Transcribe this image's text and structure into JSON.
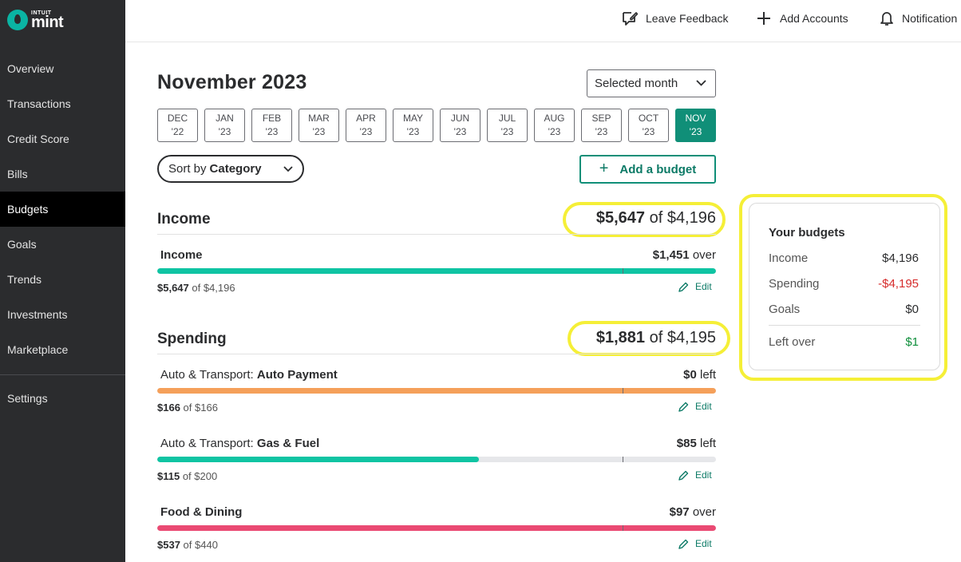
{
  "brand": {
    "intuit": "INTUIT",
    "name": "mint"
  },
  "sidebar": {
    "items": [
      {
        "label": "Overview"
      },
      {
        "label": "Transactions"
      },
      {
        "label": "Credit Score"
      },
      {
        "label": "Bills"
      },
      {
        "label": "Budgets",
        "active": true
      },
      {
        "label": "Goals"
      },
      {
        "label": "Trends"
      },
      {
        "label": "Investments"
      },
      {
        "label": "Marketplace"
      },
      {
        "label": "Settings"
      }
    ]
  },
  "topbar": {
    "feedback_label": "Leave Feedback",
    "add_accounts_label": "Add Accounts",
    "notifications_label": "Notification"
  },
  "page": {
    "title": "November 2023",
    "month_select": "Selected month",
    "months": [
      {
        "m": "DEC",
        "y": "'22"
      },
      {
        "m": "JAN",
        "y": "'23"
      },
      {
        "m": "FEB",
        "y": "'23"
      },
      {
        "m": "MAR",
        "y": "'23"
      },
      {
        "m": "APR",
        "y": "'23"
      },
      {
        "m": "MAY",
        "y": "'23"
      },
      {
        "m": "JUN",
        "y": "'23"
      },
      {
        "m": "JUL",
        "y": "'23"
      },
      {
        "m": "AUG",
        "y": "'23"
      },
      {
        "m": "SEP",
        "y": "'23"
      },
      {
        "m": "OCT",
        "y": "'23"
      },
      {
        "m": "NOV",
        "y": "'23",
        "active": true
      }
    ],
    "sort_prefix": "Sort by",
    "sort_value": "Category",
    "add_budget_label": "Add a budget"
  },
  "income": {
    "title": "Income",
    "total_actual": "$5,647",
    "total_of": "of $4,196",
    "rows": [
      {
        "category": "",
        "name": "Income",
        "status_amount": "$1,451",
        "status_word": "over",
        "actual": "$5,647",
        "of": "of $4,196",
        "edit": "Edit",
        "progress": 1.0,
        "color": "#0fc4a3"
      }
    ]
  },
  "spending": {
    "title": "Spending",
    "total_actual": "$1,881",
    "total_of": "of $4,195",
    "rows": [
      {
        "category": "Auto & Transport:",
        "name": "Auto Payment",
        "status_amount": "$0",
        "status_word": "left",
        "actual": "$166",
        "of": "of $166",
        "edit": "Edit",
        "progress": 1.0,
        "color": "#f5a05a"
      },
      {
        "category": "Auto & Transport:",
        "name": "Gas & Fuel",
        "status_amount": "$85",
        "status_word": "left",
        "actual": "$115",
        "of": "of $200",
        "edit": "Edit",
        "progress": 0.575,
        "color": "#0fc4a3"
      },
      {
        "category": "",
        "name": "Food & Dining",
        "status_amount": "$97",
        "status_word": "over",
        "actual": "$537",
        "of": "of $440",
        "edit": "Edit",
        "progress": 1.0,
        "color": "#ea4a73"
      }
    ]
  },
  "summary": {
    "title": "Your budgets",
    "rows": [
      {
        "label": "Income",
        "value": "$4,196",
        "color": "#2b2c2e"
      },
      {
        "label": "Spending",
        "value": "-$4,195",
        "color": "#d62b2b"
      },
      {
        "label": "Goals",
        "value": "$0",
        "color": "#2b2c2e"
      }
    ],
    "left_over_label": "Left over",
    "left_over_value": "$1",
    "left_over_color": "#108f3c"
  }
}
